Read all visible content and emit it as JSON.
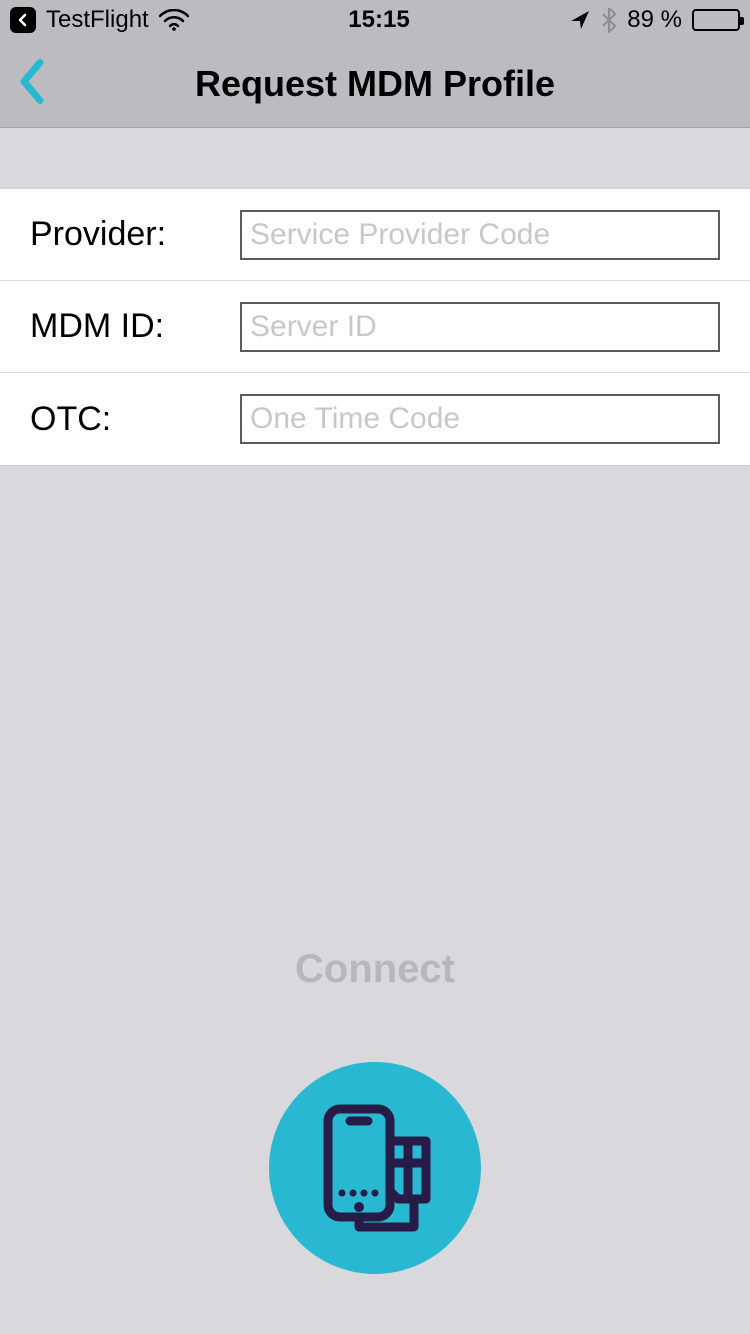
{
  "statusbar": {
    "return_app": "TestFlight",
    "time": "15:15",
    "battery_text": "89 %",
    "battery_level": 89
  },
  "navbar": {
    "title": "Request MDM Profile"
  },
  "form": {
    "provider": {
      "label": "Provider:",
      "placeholder": "Service Provider Code",
      "value": ""
    },
    "mdm_id": {
      "label": "MDM ID:",
      "placeholder": "Server ID",
      "value": ""
    },
    "otc": {
      "label": "OTC:",
      "placeholder": "One Time Code",
      "value": ""
    }
  },
  "connect": {
    "label": "Connect"
  },
  "colors": {
    "accent": "#29b8d1",
    "icon_dark": "#271b47"
  }
}
